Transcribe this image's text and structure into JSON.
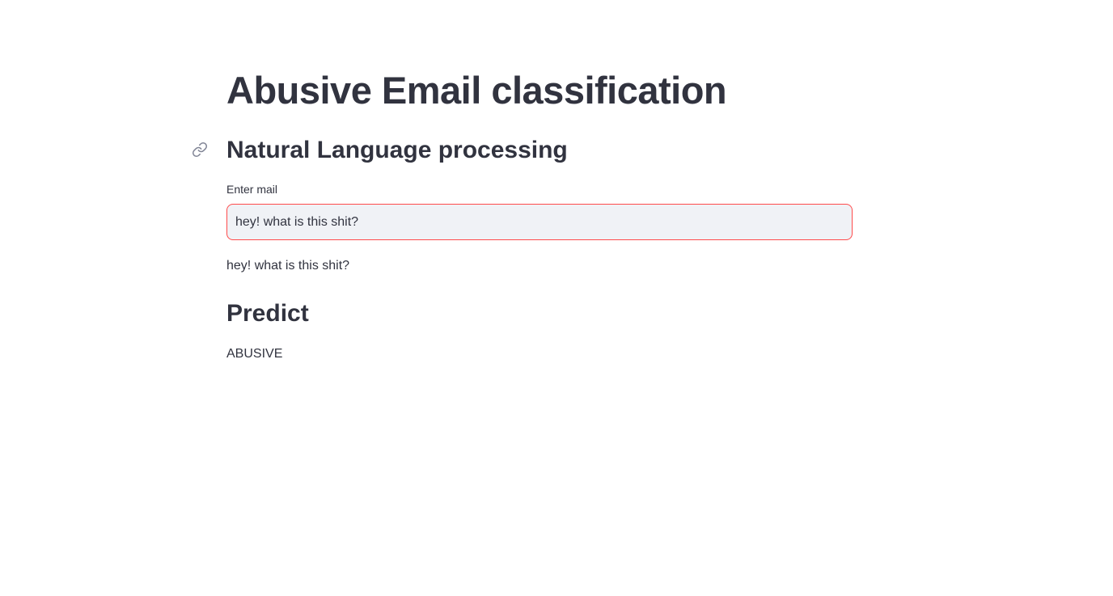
{
  "header": {
    "title": "Abusive Email classification"
  },
  "section": {
    "heading": "Natural Language processing"
  },
  "mail_input": {
    "label": "Enter mail",
    "value": "hey! what is this shit?"
  },
  "echo": {
    "text": "hey! what is this shit?"
  },
  "predict": {
    "heading": "Predict",
    "result": "ABUSIVE"
  },
  "icons": {
    "anchor": "link-icon"
  },
  "colors": {
    "text": "#31333f",
    "input_border_focus": "#ff4b4b",
    "input_background": "#f0f2f6"
  }
}
